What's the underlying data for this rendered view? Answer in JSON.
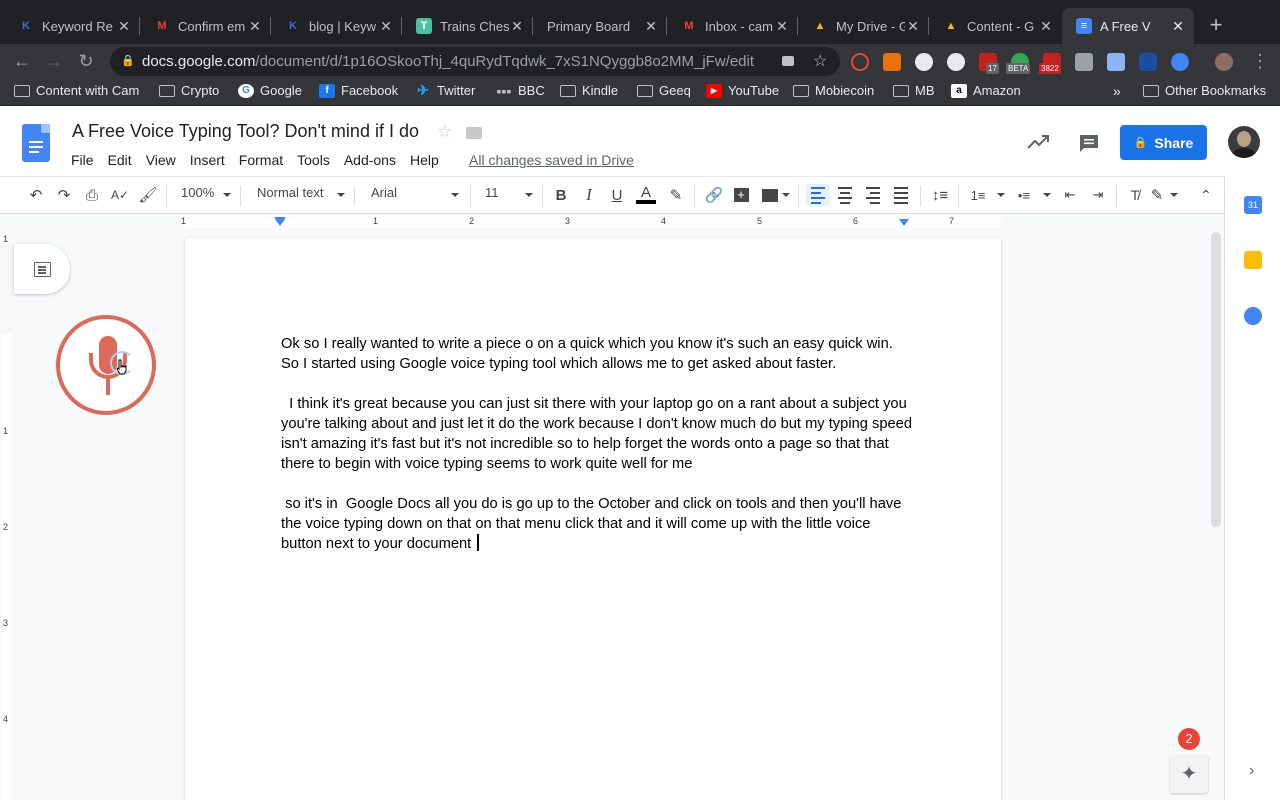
{
  "browser": {
    "tabs": [
      {
        "title": "Keyword Re",
        "icon": "keyword-revealer-favicon",
        "color": "#3f6bde",
        "glyph": "K"
      },
      {
        "title": "Confirm em",
        "icon": "gmail-favicon",
        "color": "#ea4335",
        "glyph": "M"
      },
      {
        "title": "blog | Keyw",
        "icon": "keyword-revealer-favicon",
        "color": "#3f6bde",
        "glyph": "K"
      },
      {
        "title": "Trains Ches",
        "icon": "trello-favicon",
        "color": "#4bbf9f",
        "glyph": "T"
      },
      {
        "title": "Primary Board",
        "icon": "",
        "color": "",
        "glyph": ""
      },
      {
        "title": "Inbox - cam",
        "icon": "gmail-favicon",
        "color": "#ea4335",
        "glyph": "M"
      },
      {
        "title": "My Drive - G",
        "icon": "google-drive-favicon",
        "color": "#fbbc04",
        "glyph": "▲"
      },
      {
        "title": "Content - G",
        "icon": "google-drive-favicon",
        "color": "#fbbc04",
        "glyph": "▲"
      },
      {
        "title": "A Free V",
        "icon": "google-docs-favicon",
        "color": "#4285f4",
        "glyph": "≡"
      }
    ],
    "url_host": "docs.google.com",
    "url_path": "/document/d/1p16OSkooThj_4quRydTqdwk_7xS1NQyggb8o2MM_jFw/edit",
    "extension_badges": {
      "ext1": "17",
      "ext2": "BETA",
      "ext3": "3822"
    },
    "bookmarks": [
      {
        "label": "Content with Cam",
        "icon": "folder-icon"
      },
      {
        "label": "Crypto",
        "icon": "folder-icon"
      },
      {
        "label": "Google",
        "icon": "google-icon"
      },
      {
        "label": "Facebook",
        "icon": "facebook-icon"
      },
      {
        "label": "Twitter",
        "icon": "twitter-icon"
      },
      {
        "label": "BBC",
        "icon": "bbc-icon"
      },
      {
        "label": "Kindle",
        "icon": "folder-icon"
      },
      {
        "label": "Geeq",
        "icon": "folder-icon"
      },
      {
        "label": "YouTube",
        "icon": "youtube-icon"
      },
      {
        "label": "Mobiecoin",
        "icon": "folder-icon"
      },
      {
        "label": "MB",
        "icon": "folder-icon"
      },
      {
        "label": "Amazon",
        "icon": "amazon-icon"
      }
    ],
    "overflow_label": "»",
    "other_bookmarks": "Other Bookmarks"
  },
  "docs": {
    "title": "A Free Voice Typing Tool? Don't mind if I do",
    "menu": [
      "File",
      "Edit",
      "View",
      "Insert",
      "Format",
      "Tools",
      "Add-ons",
      "Help"
    ],
    "save_status": "All changes saved in Drive",
    "share_label": "Share",
    "toolbar": {
      "zoom": "100%",
      "style": "Normal text",
      "font": "Arial",
      "size": "11",
      "bold": "B",
      "italic": "I",
      "underline": "U",
      "text_color": "A"
    },
    "ruler_h": [
      "1",
      "1",
      "2",
      "3",
      "4",
      "5",
      "6",
      "7"
    ],
    "ruler_v": [
      "1",
      "1",
      "2",
      "3",
      "4"
    ],
    "body": [
      "Ok so I really wanted to write a piece o on a quick which you know it's such an easy quick win. So I started using Google voice typing tool which allows me to get asked about faster.",
      "  I think it's great because you can just sit there with your laptop go on a rant about a subject you you're talking about and just let it do the work because I don't know much do but my typing speed isn't amazing it's fast but it's not incredible so to help forget the words onto a page so that that there to begin with voice typing seems to work quite well for me",
      " so it's in  Google Docs all you do is go up to the October and click on tools and then you'll have the voice typing down on that on that menu click that and it will come up with the little voice button next to your document "
    ],
    "calendar_day": "31",
    "notification_count": "2",
    "colors": {
      "accent": "#1a73e8",
      "voice": "#dd6a59",
      "badge": "#ea4335"
    }
  }
}
